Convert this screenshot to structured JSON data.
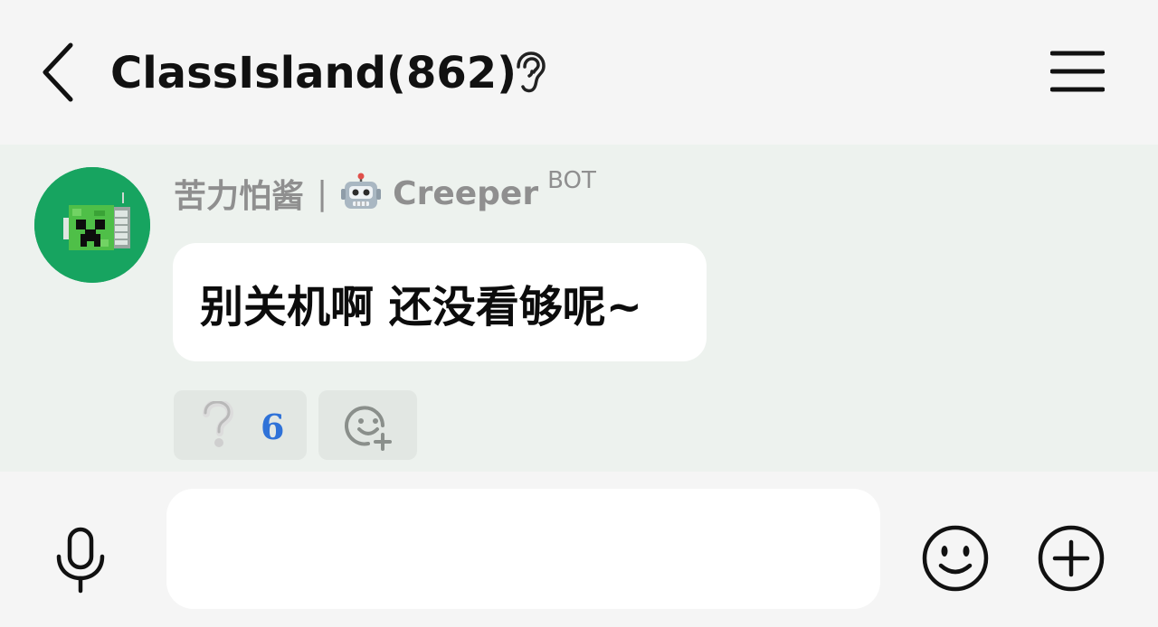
{
  "header": {
    "title": "ClassIsland(862)",
    "back_icon": "chevron-left-icon",
    "listen_icon": "ear-icon",
    "menu_icon": "hamburger-menu-icon"
  },
  "message": {
    "sender_name": "苦力怕酱",
    "separator": "|",
    "robot_icon": "robot-icon",
    "bot_name": "Creeper",
    "bot_badge": "BOT",
    "text": "别关机啊 还没看够呢~",
    "avatar_color": "#17a460",
    "reaction": {
      "icon": "question-mark-icon",
      "count": "6"
    },
    "add_reaction_icon": "add-emoji-icon"
  },
  "input_bar": {
    "mic_icon": "microphone-icon",
    "text_value": "",
    "emoji_icon": "smiley-icon",
    "plus_icon": "plus-circle-icon"
  },
  "colors": {
    "header_bg": "#f5f5f5",
    "message_area_bg": "#edf2ee",
    "reaction_count": "#2f72d8",
    "muted_text": "#8f8f8f"
  }
}
